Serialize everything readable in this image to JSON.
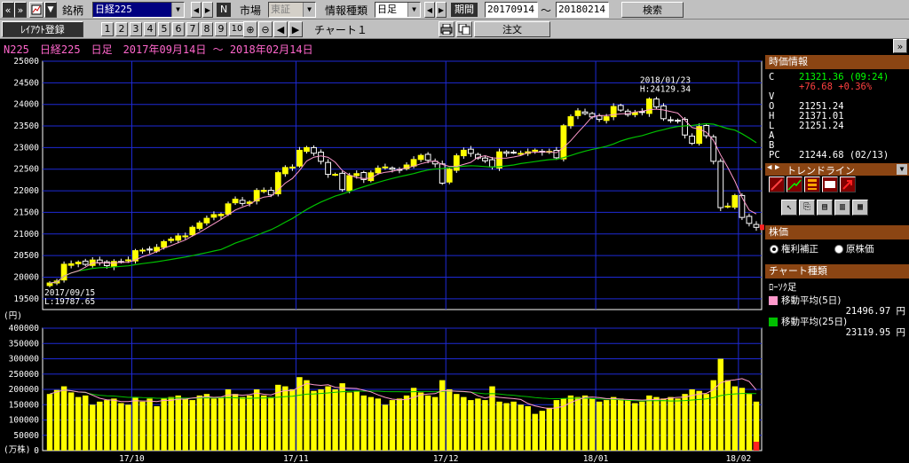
{
  "toolbar1": {
    "nav_left": "«",
    "nav_right": "»",
    "stock_label": "銘柄",
    "stock_value": "日経225",
    "code_label": "N",
    "market_label": "市場",
    "market_value": "東証",
    "info_label": "情報種類",
    "info_value": "日足",
    "period_label": "期間",
    "period_from": "20170914",
    "period_sep": "～",
    "period_to": "20180214",
    "search_button": "検索"
  },
  "toolbar2": {
    "layout_button": "ﾚｲｱｳﾄ登録",
    "layout_numbers": [
      "1",
      "2",
      "3",
      "4",
      "5",
      "6",
      "7",
      "8",
      "9",
      "10"
    ],
    "chart_label": "チャート１",
    "order_button": "注文"
  },
  "title_line": "N225　日経225　日足　2017年09月14日 ～ 2018年02月14日",
  "colors": {
    "up": "#ffff00",
    "down": "#000000",
    "ma5": "#ff99cc",
    "ma25": "#00c000",
    "grid": "#1e2ad6",
    "volume": "#ffff00",
    "header_bg": "#8b4513"
  },
  "side": {
    "collapse_icon": "»",
    "price_header": "時価情報",
    "price_rows": [
      {
        "k": "C",
        "v": "21321.36 (09:24)",
        "color": "#00ff00"
      },
      {
        "k": "",
        "v": "+76.68 +0.36%",
        "color": "#ff4040"
      },
      {
        "k": "V",
        "v": "",
        "color": "#ffffff"
      },
      {
        "k": "O",
        "v": "21251.24",
        "color": "#ffffff"
      },
      {
        "k": "H",
        "v": "21371.01",
        "color": "#ffffff"
      },
      {
        "k": "L",
        "v": "21251.24",
        "color": "#ffffff"
      },
      {
        "k": "A",
        "v": "",
        "color": "#ffffff"
      },
      {
        "k": "B",
        "v": "",
        "color": "#ffffff"
      },
      {
        "k": "PC",
        "v": "21244.68 (02/13)",
        "color": "#ffffff"
      }
    ],
    "trendline_label": "トレンドライン",
    "stock_header": "株価",
    "radio_adjusted": "権利補正",
    "radio_original": "原株価",
    "chart_type_header": "チャート種類",
    "chart_type": "ﾛｰｿｸ足",
    "ma5_label": "移動平均(5日)",
    "ma5_value": "21496.97 円",
    "ma25_label": "移動平均(25日)",
    "ma25_value": "23119.95 円"
  },
  "chart_data": {
    "type": "candlestick",
    "price_ticks": [
      19500,
      20000,
      20500,
      21000,
      21500,
      22000,
      22500,
      23000,
      23500,
      24000,
      24500,
      25000
    ],
    "ylim": [
      19250,
      25000
    ],
    "price_unit": "(円)",
    "volume_ticks": [
      0,
      50000,
      100000,
      150000,
      200000,
      250000,
      300000,
      350000,
      400000
    ],
    "volume_ylim": [
      0,
      400000
    ],
    "volume_unit": "(万株)",
    "x_ticks": [
      {
        "label": "17/10",
        "index": 12
      },
      {
        "label": "17/11",
        "index": 35
      },
      {
        "label": "17/12",
        "index": 56
      },
      {
        "label": "18/01",
        "index": 77
      },
      {
        "label": "18/02",
        "index": 97
      }
    ],
    "annotations": [
      {
        "text1": "2018/01/23",
        "text2": "H:24129.34",
        "index": 87,
        "value": 24129.34
      },
      {
        "text1": "2017/09/15",
        "text2": "L:19787.65",
        "index": 1,
        "value": 19787.65
      }
    ],
    "dates": [
      "09/14",
      "09/15",
      "09/19",
      "09/20",
      "09/21",
      "09/22",
      "09/25",
      "09/26",
      "09/27",
      "09/28",
      "09/29",
      "10/02",
      "10/03",
      "10/04",
      "10/05",
      "10/06",
      "10/10",
      "10/11",
      "10/12",
      "10/13",
      "10/16",
      "10/17",
      "10/18",
      "10/19",
      "10/20",
      "10/23",
      "10/24",
      "10/25",
      "10/26",
      "10/27",
      "10/30",
      "10/31",
      "11/01",
      "11/02",
      "11/06",
      "11/07",
      "11/08",
      "11/09",
      "11/10",
      "11/13",
      "11/14",
      "11/15",
      "11/16",
      "11/17",
      "11/20",
      "11/21",
      "11/22",
      "11/24",
      "11/27",
      "11/28",
      "11/29",
      "11/30",
      "12/01",
      "12/04",
      "12/05",
      "12/06",
      "12/07",
      "12/08",
      "12/11",
      "12/12",
      "12/13",
      "12/14",
      "12/15",
      "12/18",
      "12/19",
      "12/20",
      "12/21",
      "12/22",
      "12/25",
      "12/26",
      "12/27",
      "12/28",
      "01/04",
      "01/05",
      "01/09",
      "01/10",
      "01/11",
      "01/12",
      "01/15",
      "01/16",
      "01/17",
      "01/18",
      "01/19",
      "01/22",
      "01/23",
      "01/24",
      "01/25",
      "01/26",
      "01/29",
      "01/30",
      "01/31",
      "02/01",
      "02/02",
      "02/05",
      "02/06",
      "02/07",
      "02/08",
      "02/09",
      "02/13",
      "02/14"
    ],
    "close": [
      19865,
      19910,
      20299,
      20310,
      20347,
      20296,
      20397,
      20330,
      20267,
      20363,
      20356,
      20400,
      20614,
      20626,
      20628,
      20690,
      20823,
      20881,
      20955,
      20955,
      21155,
      21256,
      21363,
      21448,
      21457,
      21697,
      21805,
      21707,
      21739,
      22008,
      22011,
      21904,
      22420,
      22539,
      22548,
      22937,
      23000,
      22869,
      22681,
      22380,
      22380,
      22028,
      22351,
      22397,
      22261,
      22416,
      22523,
      22551,
      22495,
      22486,
      22597,
      22724,
      22819,
      22707,
      22622,
      22177,
      22499,
      22811,
      22938,
      22866,
      22758,
      22694,
      22553,
      22901,
      22868,
      22891,
      22866,
      22902,
      22939,
      22893,
      22911,
      22764,
      23506,
      23715,
      23850,
      23788,
      23710,
      23653,
      23714,
      23951,
      23868,
      23763,
      23808,
      23816,
      24124,
      23940,
      23669,
      23632,
      23629,
      23291,
      23098,
      23486,
      23274,
      22682,
      21610,
      21645,
      21891,
      21383,
      21245,
      21154
    ],
    "volume": [
      185000,
      198000,
      210000,
      190000,
      175000,
      180000,
      150000,
      160000,
      165000,
      170000,
      155000,
      150000,
      175000,
      160000,
      170000,
      145000,
      170000,
      175000,
      180000,
      170000,
      165000,
      180000,
      185000,
      170000,
      175000,
      200000,
      185000,
      175000,
      180000,
      200000,
      180000,
      175000,
      215000,
      210000,
      200000,
      240000,
      230000,
      195000,
      200000,
      210000,
      200000,
      220000,
      190000,
      195000,
      180000,
      175000,
      170000,
      150000,
      165000,
      170000,
      180000,
      205000,
      190000,
      180000,
      175000,
      230000,
      200000,
      185000,
      175000,
      165000,
      170000,
      165000,
      210000,
      160000,
      155000,
      160000,
      150000,
      145000,
      120000,
      130000,
      140000,
      165000,
      170000,
      180000,
      175000,
      180000,
      170000,
      160000,
      165000,
      175000,
      170000,
      165000,
      155000,
      160000,
      180000,
      175000,
      170000,
      175000,
      170000,
      185000,
      200000,
      195000,
      185000,
      230000,
      300000,
      230000,
      210000,
      205000,
      185000,
      160000
    ]
  }
}
